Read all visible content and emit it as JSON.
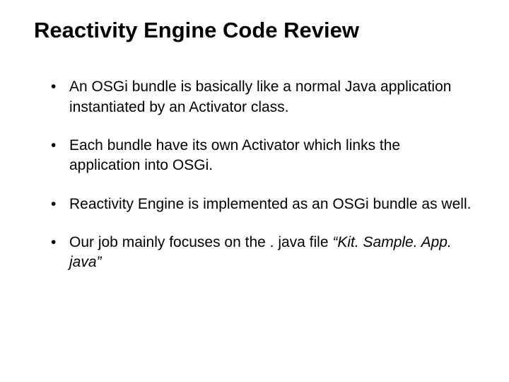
{
  "title": "Reactivity Engine Code Review",
  "bullets": [
    "An OSGi bundle is basically like a normal Java application instantiated by an Activator class.",
    "Each bundle have its own Activator which links the application into OSGi.",
    "Reactivity Engine is implemented as an OSGi bundle as well.",
    "Our job mainly focuses on the . java file "
  ],
  "italic_trail": "“Kit. Sample. App. java”"
}
